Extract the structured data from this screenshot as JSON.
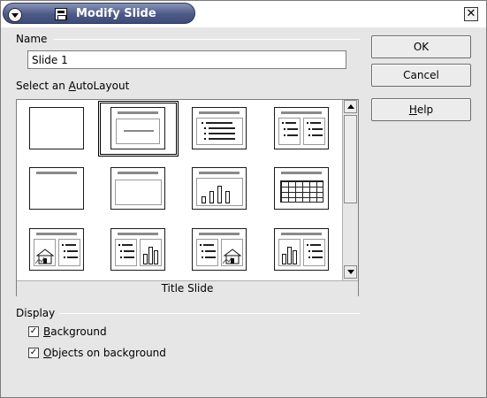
{
  "window": {
    "title": "Modify Slide",
    "close_glyph": "✕"
  },
  "name_section": {
    "heading": "Name",
    "value": "Slide 1"
  },
  "autolayout": {
    "heading_pre": "Select an ",
    "heading_mnemonic": "A",
    "heading_post": "utoLayout",
    "selected_caption": "Title Slide",
    "layouts": [
      {
        "name": "blank-layout"
      },
      {
        "name": "title-slide-layout",
        "selected": true
      },
      {
        "name": "title-content-layout"
      },
      {
        "name": "title-2-content-layout"
      },
      {
        "name": "title-only-layout"
      },
      {
        "name": "centered-text-layout"
      },
      {
        "name": "title-chart-layout"
      },
      {
        "name": "title-table-layout"
      },
      {
        "name": "title-image-text-layout"
      },
      {
        "name": "title-text-chart-layout"
      },
      {
        "name": "title-text-image-layout"
      },
      {
        "name": "title-chart-text-layout"
      }
    ]
  },
  "buttons": {
    "ok": "OK",
    "cancel": "Cancel",
    "help_mnemonic": "H",
    "help_rest": "elp"
  },
  "display": {
    "heading": "Display",
    "background_mnemonic": "B",
    "background_rest": "ackground",
    "background_checked": true,
    "objects_mnemonic": "O",
    "objects_rest": "bjects on background",
    "objects_checked": true,
    "check_glyph": "✓"
  },
  "colors": {
    "titlebar_accent": "#4d5a87",
    "dialog_bg": "#e6e6e6"
  }
}
